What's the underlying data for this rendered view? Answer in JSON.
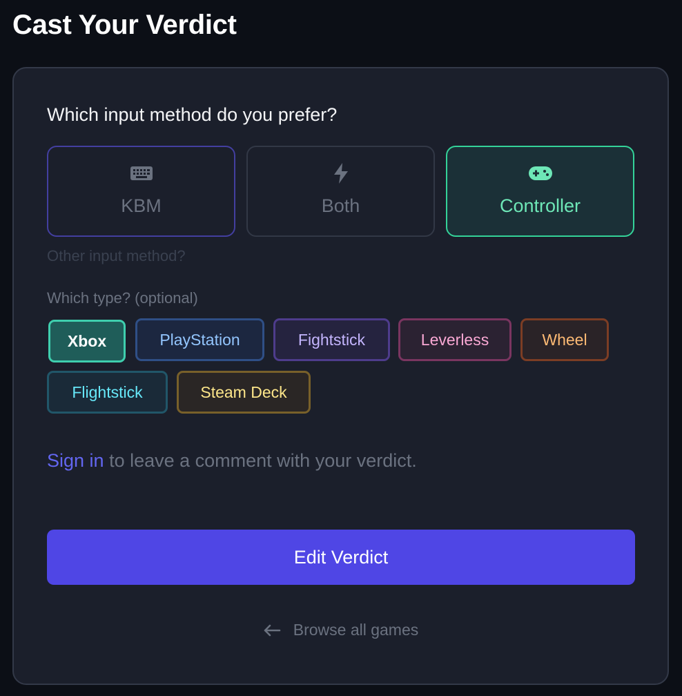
{
  "page": {
    "title": "Cast Your Verdict"
  },
  "form": {
    "question": "Which input method do you prefer?",
    "methods": [
      {
        "label": "KBM",
        "icon": "keyboard-icon",
        "state": "hover"
      },
      {
        "label": "Both",
        "icon": "lightning-icon",
        "state": "default"
      },
      {
        "label": "Controller",
        "icon": "gamepad-icon",
        "state": "selected"
      }
    ],
    "other_method_link": "Other input method?",
    "type_label": "Which type? (optional)",
    "types": [
      {
        "label": "Xbox",
        "selected": true
      },
      {
        "label": "PlayStation"
      },
      {
        "label": "Fightstick"
      },
      {
        "label": "Leverless"
      },
      {
        "label": "Wheel"
      },
      {
        "label": "Flightstick"
      },
      {
        "label": "Steam Deck"
      }
    ],
    "signin": {
      "link": "Sign in",
      "rest": " to leave a comment with your verdict."
    },
    "submit_label": "Edit Verdict",
    "browse_label": "Browse all games"
  },
  "colors": {
    "accent": "#4f46e5",
    "selected_green": "#34d399",
    "background": "#0c0f16",
    "card": "#1b1f2b"
  }
}
